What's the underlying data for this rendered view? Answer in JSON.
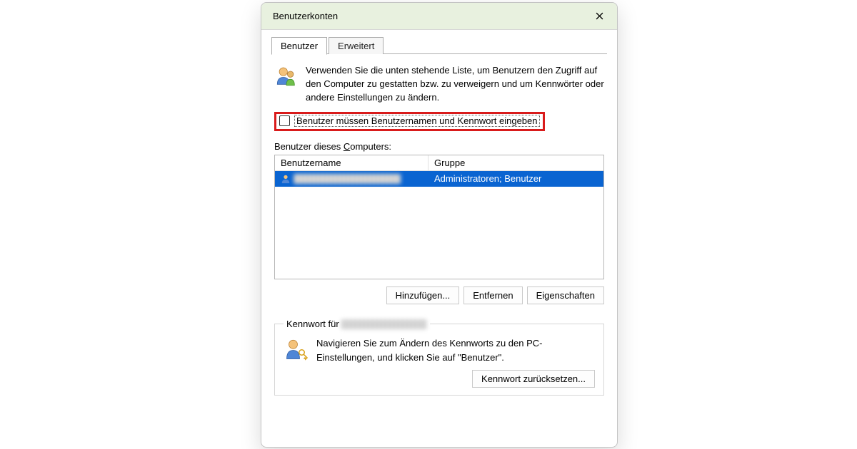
{
  "dialog": {
    "title": "Benutzerkonten"
  },
  "tabs": {
    "user": "Benutzer",
    "advanced": "Erweitert"
  },
  "intro": "Verwenden Sie die unten stehende Liste, um Benutzern den Zugriff auf den Computer zu gestatten bzw. zu verweigern und um Kennwörter oder andere Einstellungen zu ändern.",
  "checkbox": {
    "label": "Benutzer müssen Benutzernamen und Kennwort eingeben"
  },
  "userlist": {
    "label_prefix": "Benutzer dieses ",
    "label_underline": "C",
    "label_suffix": "omputers:",
    "columns": {
      "name": "Benutzername",
      "group": "Gruppe"
    },
    "rows": [
      {
        "name_obscured": true,
        "group": "Administratoren; Benutzer"
      }
    ]
  },
  "buttons": {
    "add": "Hinzufügen...",
    "remove": "Entfernen",
    "properties": "Eigenschaften"
  },
  "password_box": {
    "legend_prefix": "Kennwort für ",
    "text": "Navigieren Sie zum Ändern des Kennworts zu den PC-Einstellungen, und klicken Sie auf \"Benutzer\".",
    "reset": "Kennwort zurücksetzen..."
  }
}
